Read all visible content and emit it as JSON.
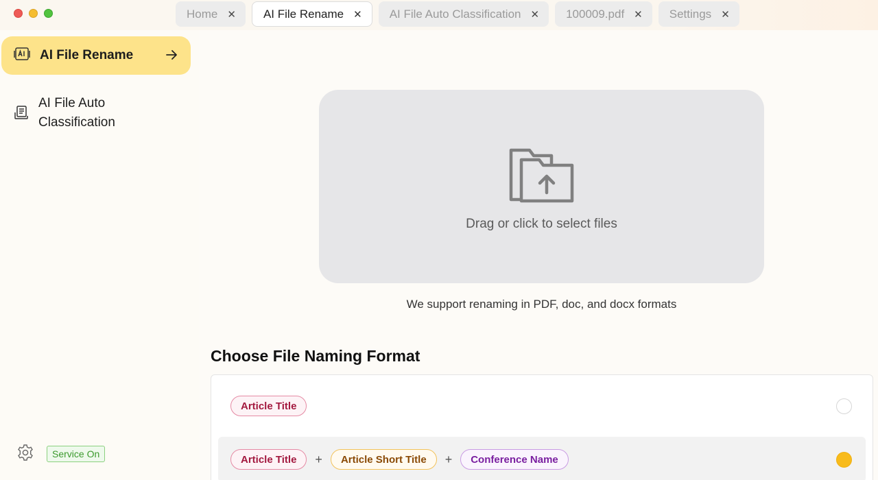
{
  "tabs": [
    {
      "label": "Home"
    },
    {
      "label": "AI File Rename"
    },
    {
      "label": "AI File Auto Classification"
    },
    {
      "label": "100009.pdf"
    },
    {
      "label": "Settings"
    }
  ],
  "close_glyph": "✕",
  "sidebar": {
    "items": [
      {
        "label": "AI File Rename",
        "icon": "ai-text-icon"
      },
      {
        "label": "AI File Auto Classification",
        "icon": "document-stack-icon"
      }
    ],
    "service_status": "Service On"
  },
  "dropzone": {
    "text": "Drag or click to select files",
    "support_text": "We support renaming in PDF, doc, and docx formats"
  },
  "naming": {
    "title": "Choose File Naming Format",
    "options": [
      {
        "chips": [
          "Article Title"
        ],
        "selected": false
      },
      {
        "chips": [
          "Article Title",
          "Article Short Title",
          "Conference Name"
        ],
        "selected": true
      }
    ],
    "plus": "+"
  },
  "colors": {
    "accent": "#fde38a",
    "radio_selected": "#f8bb1c",
    "service_on": "#3c9a2e"
  }
}
